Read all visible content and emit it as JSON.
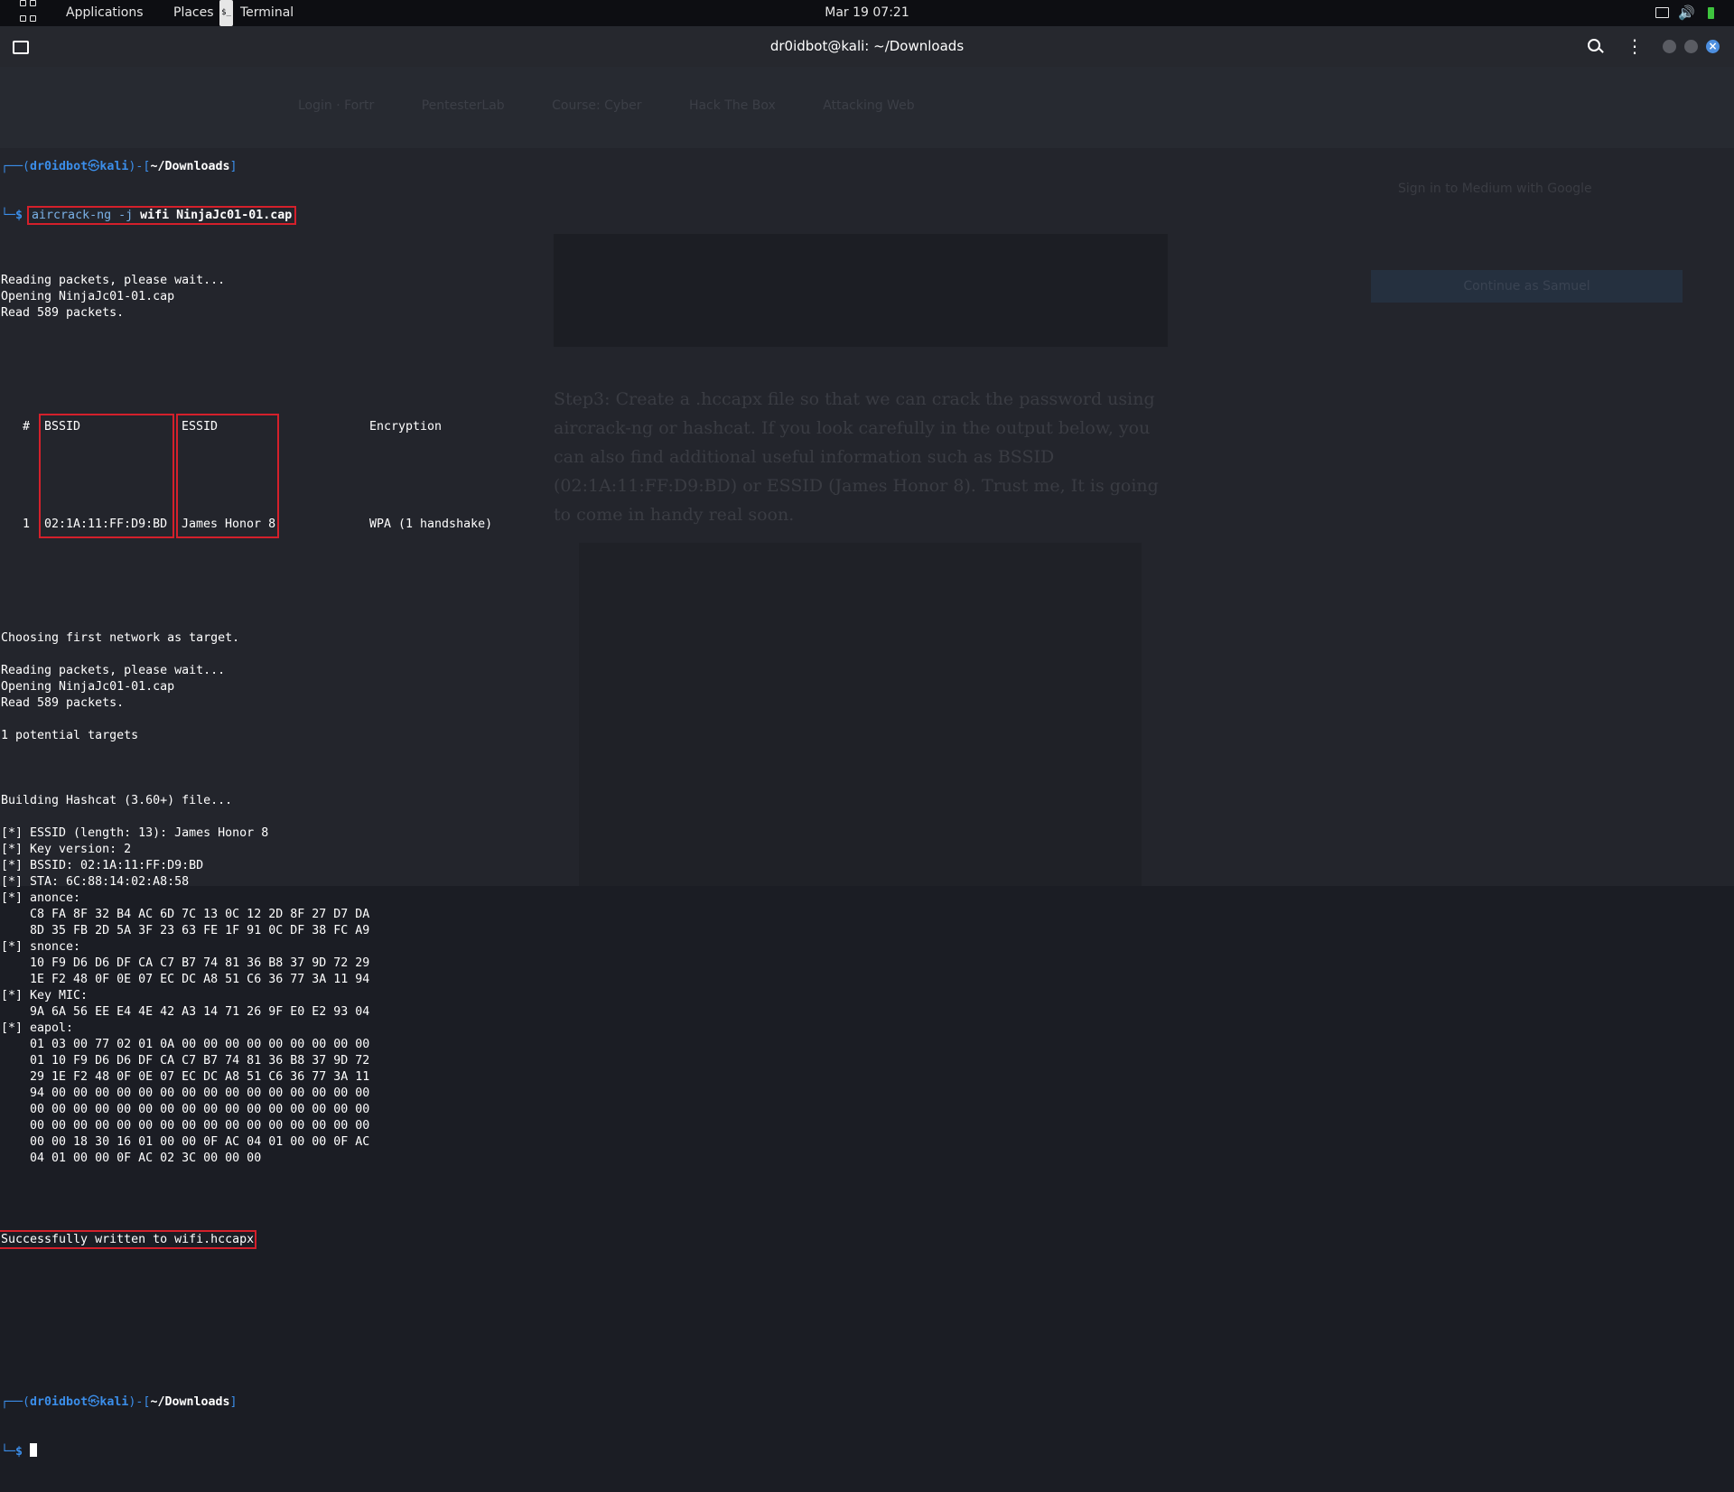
{
  "topbar": {
    "applications_label": "Applications",
    "places_label": "Places",
    "terminal_label": "Terminal",
    "clock": "Mar 19  07:21",
    "terminal_icon_glyph": "$_"
  },
  "window": {
    "title": "dr0idbot@kali: ~/Downloads"
  },
  "ghost": {
    "tabs": [
      "Login · Fortr",
      "PentesterLab",
      "Course: Cyber",
      "Hack The Box",
      "Attacking Web"
    ],
    "article": "Step3: Create a .hccapx file so that we can crack the password using aircrack-ng or hashcat. If you look carefully in the output below, you can also find additional useful information such as BSSID (02:1A:11:FF:D9:BD) or ESSID (James Honor 8). Trust me, It is going to come in handy real soon.",
    "signin": "Sign in to Medium with Google",
    "continue": "Continue as Samuel"
  },
  "terminal": {
    "prompt_user": "dr0idbot",
    "prompt_at": "㉿",
    "prompt_host": "kali",
    "prompt_dir": "~/Downloads",
    "prompt_corner_top": "┌──(",
    "prompt_corner_mid": ")-[",
    "prompt_corner_end": "]",
    "prompt_corner_bottom": "└─",
    "prompt_dollar": "$ ",
    "command_prog": "aircrack-ng -j",
    "command_args": " wifi NinjaJc01-01.cap",
    "lines_a": [
      "Reading packets, please wait...",
      "Opening NinjaJc01-01.cap",
      "Read 589 packets."
    ],
    "table": {
      "hash": "   #",
      "bssid_header": "BSSID",
      "essid_header": "ESSID",
      "enc_header": "Encryption",
      "row_index": "   1",
      "row_bssid": "02:1A:11:FF:D9:BD",
      "row_essid": "James Honor 8",
      "row_enc": "WPA (1 handshake)"
    },
    "lines_b": [
      "Choosing first network as target.",
      "",
      "Reading packets, please wait...",
      "Opening NinjaJc01-01.cap",
      "Read 589 packets.",
      "",
      "1 potential targets",
      "",
      "",
      "",
      "Building Hashcat (3.60+) file...",
      "",
      "[*] ESSID (length: 13): James Honor 8",
      "[*] Key version: 2",
      "[*] BSSID: 02:1A:11:FF:D9:BD",
      "[*] STA: 6C:88:14:02:A8:58",
      "[*] anonce:",
      "    C8 FA 8F 32 B4 AC 6D 7C 13 0C 12 2D 8F 27 D7 DA",
      "    8D 35 FB 2D 5A 3F 23 63 FE 1F 91 0C DF 38 FC A9",
      "[*] snonce:",
      "    10 F9 D6 D6 DF CA C7 B7 74 81 36 B8 37 9D 72 29",
      "    1E F2 48 0F 0E 07 EC DC A8 51 C6 36 77 3A 11 94",
      "[*] Key MIC:",
      "    9A 6A 56 EE E4 4E 42 A3 14 71 26 9F E0 E2 93 04",
      "[*] eapol:",
      "    01 03 00 77 02 01 0A 00 00 00 00 00 00 00 00 00",
      "    01 10 F9 D6 D6 DF CA C7 B7 74 81 36 B8 37 9D 72",
      "    29 1E F2 48 0F 0E 07 EC DC A8 51 C6 36 77 3A 11",
      "    94 00 00 00 00 00 00 00 00 00 00 00 00 00 00 00",
      "    00 00 00 00 00 00 00 00 00 00 00 00 00 00 00 00",
      "    00 00 00 00 00 00 00 00 00 00 00 00 00 00 00 00",
      "    00 00 18 30 16 01 00 00 0F AC 04 01 00 00 0F AC",
      "    04 01 00 00 0F AC 02 3C 00 00 00",
      ""
    ],
    "success": "Successfully written to wifi.hccapx"
  },
  "colors": {
    "accent_blue": "#3b8eea",
    "highlight_red": "#d4202b",
    "battery_green": "#3ec43e"
  },
  "icons": [
    "grid-icon",
    "terminal-app-icon",
    "new-tab-icon",
    "search-icon",
    "kebab-menu-icon",
    "screen-icon",
    "volume-icon",
    "power-icon",
    "battery-icon"
  ]
}
